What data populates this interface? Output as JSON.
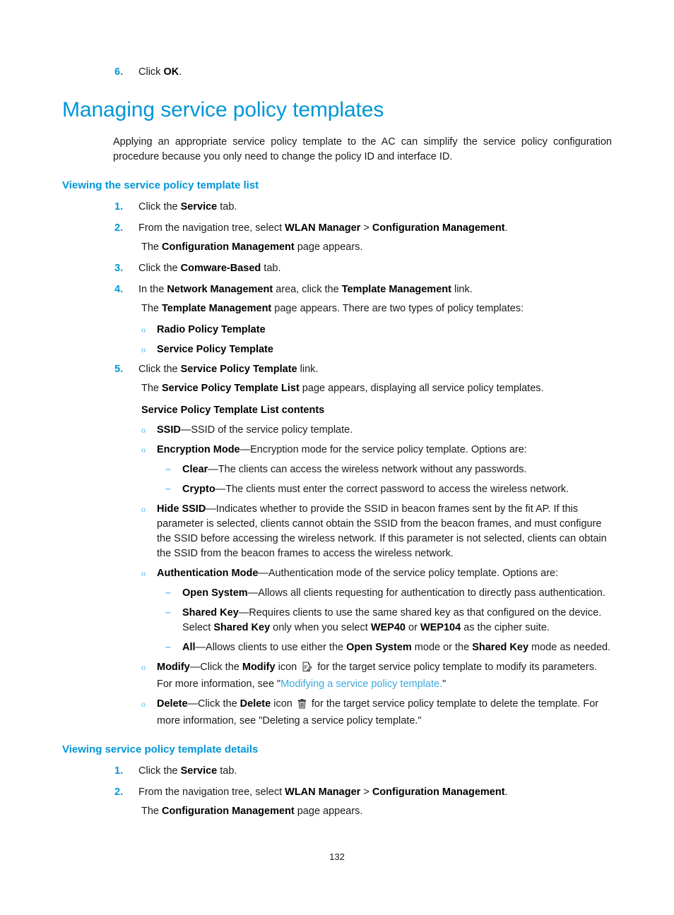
{
  "document": {
    "page_number": "132",
    "accent_color": "#0096D6",
    "bullet_color": "#52B8E8",
    "dash_color": "#6EC6EE",
    "link_color": "#3BA9DF"
  },
  "top_step": {
    "number": "6.",
    "text_before": "Click ",
    "bold": "OK",
    "text_after": "."
  },
  "heading": {
    "title": "Managing service policy templates",
    "intro": "Applying an appropriate service policy template to the AC can simplify the service policy configuration procedure because you only need to change the policy ID and interface ID."
  },
  "section_list": {
    "heading": "Viewing the service policy template list",
    "steps": [
      {
        "number": "1.",
        "parts": [
          {
            "t": "Click the ",
            "style": "normal"
          },
          {
            "t": "Service",
            "style": "bold"
          },
          {
            "t": " tab.",
            "style": "normal"
          }
        ]
      },
      {
        "number": "2.",
        "parts": [
          {
            "t": "From the navigation tree, select ",
            "style": "normal"
          },
          {
            "t": "WLAN Manager",
            "style": "bold"
          },
          {
            "t": " > ",
            "style": "normal"
          },
          {
            "t": "Configuration Management",
            "style": "bold"
          },
          {
            "t": ".",
            "style": "normal"
          }
        ],
        "follow": [
          {
            "t": "The ",
            "style": "normal"
          },
          {
            "t": "Configuration Management",
            "style": "bold"
          },
          {
            "t": " page appears.",
            "style": "normal"
          }
        ]
      },
      {
        "number": "3.",
        "parts": [
          {
            "t": "Click the ",
            "style": "normal"
          },
          {
            "t": "Comware-Based",
            "style": "bold"
          },
          {
            "t": " tab.",
            "style": "normal"
          }
        ]
      },
      {
        "number": "4.",
        "parts": [
          {
            "t": "In the ",
            "style": "normal"
          },
          {
            "t": "Network Management",
            "style": "bold"
          },
          {
            "t": " area, click the ",
            "style": "normal"
          },
          {
            "t": "Template Management",
            "style": "bold"
          },
          {
            "t": " link.",
            "style": "normal"
          }
        ],
        "follow": [
          {
            "t": "The ",
            "style": "normal"
          },
          {
            "t": "Template Management",
            "style": "bold"
          },
          {
            "t": " page appears. There are two types of policy templates:",
            "style": "normal"
          }
        ]
      }
    ],
    "template_types": [
      [
        {
          "t": "Radio Policy Template",
          "style": "bold"
        }
      ],
      [
        {
          "t": "Service Policy Template",
          "style": "bold"
        }
      ]
    ],
    "step5": {
      "number": "5.",
      "parts": [
        {
          "t": "Click the ",
          "style": "normal"
        },
        {
          "t": "Service Policy Template",
          "style": "bold"
        },
        {
          "t": " link.",
          "style": "normal"
        }
      ],
      "follow": [
        {
          "t": "The ",
          "style": "normal"
        },
        {
          "t": "Service Policy Template List",
          "style": "bold"
        },
        {
          "t": " page appears, displaying all service policy templates.",
          "style": "normal"
        }
      ]
    },
    "contents_heading": "Service Policy Template List contents",
    "contents": [
      {
        "parts": [
          {
            "t": "SSID",
            "style": "bold"
          },
          {
            "t": "—SSID of the service policy template.",
            "style": "normal"
          }
        ]
      },
      {
        "parts": [
          {
            "t": "Encryption Mode",
            "style": "bold"
          },
          {
            "t": "—Encryption mode for the service policy template. Options are:",
            "style": "normal"
          }
        ],
        "sub": [
          [
            {
              "t": "Clear",
              "style": "bold"
            },
            {
              "t": "—The clients can access the wireless network without any passwords.",
              "style": "normal"
            }
          ],
          [
            {
              "t": "Crypto",
              "style": "bold"
            },
            {
              "t": "—The clients must enter the correct password to access the wireless network.",
              "style": "normal"
            }
          ]
        ]
      },
      {
        "parts": [
          {
            "t": "Hide SSID",
            "style": "bold"
          },
          {
            "t": "—Indicates whether to provide the SSID in beacon frames sent by the fit AP. If this parameter is selected, clients cannot obtain the SSID from the beacon frames, and must configure the SSID before accessing the wireless network. If this parameter is not selected, clients can obtain the SSID from the beacon frames to access the wireless network.",
            "style": "normal"
          }
        ]
      },
      {
        "parts": [
          {
            "t": "Authentication Mode",
            "style": "bold"
          },
          {
            "t": "—Authentication mode of the service policy template. Options are:",
            "style": "normal"
          }
        ],
        "sub": [
          [
            {
              "t": "Open System",
              "style": "bold"
            },
            {
              "t": "—Allows all clients requesting for authentication to directly pass authentication.",
              "style": "normal"
            }
          ],
          [
            {
              "t": "Shared Key",
              "style": "bold"
            },
            {
              "t": "—Requires clients to use the same shared key as that configured on the device. Select ",
              "style": "normal"
            },
            {
              "t": "Shared Key",
              "style": "bold"
            },
            {
              "t": " only when you select ",
              "style": "normal"
            },
            {
              "t": "WEP40",
              "style": "bold"
            },
            {
              "t": " or ",
              "style": "normal"
            },
            {
              "t": "WEP104",
              "style": "bold"
            },
            {
              "t": " as the cipher suite.",
              "style": "normal"
            }
          ],
          [
            {
              "t": "All",
              "style": "bold"
            },
            {
              "t": "—Allows clients to use either the ",
              "style": "normal"
            },
            {
              "t": "Open System",
              "style": "bold"
            },
            {
              "t": " mode or the ",
              "style": "normal"
            },
            {
              "t": "Shared Key",
              "style": "bold"
            },
            {
              "t": " mode as needed.",
              "style": "normal"
            }
          ]
        ]
      },
      {
        "icon": "modify-icon",
        "parts": [
          {
            "t": "Modify",
            "style": "bold"
          },
          {
            "t": "—Click the ",
            "style": "normal"
          },
          {
            "t": "Modify",
            "style": "bold"
          },
          {
            "t": " icon ",
            "style": "normal"
          },
          {
            "t": "",
            "style": "icon-modify"
          },
          {
            "t": " for the target service policy template to modify its parameters. For more information, see \"",
            "style": "normal"
          },
          {
            "t": "Modifying a service policy template.",
            "style": "link"
          },
          {
            "t": "\"",
            "style": "normal"
          }
        ]
      },
      {
        "icon": "delete-icon",
        "parts": [
          {
            "t": "Delete",
            "style": "bold"
          },
          {
            "t": "—Click the ",
            "style": "normal"
          },
          {
            "t": "Delete",
            "style": "bold"
          },
          {
            "t": " icon ",
            "style": "normal"
          },
          {
            "t": "",
            "style": "icon-delete"
          },
          {
            "t": " for the target service policy template to delete the template. For more information, see \"Deleting a service policy template.\"",
            "style": "normal"
          }
        ]
      }
    ]
  },
  "section_details": {
    "heading": "Viewing service policy template details",
    "steps": [
      {
        "number": "1.",
        "parts": [
          {
            "t": "Click the ",
            "style": "normal"
          },
          {
            "t": "Service",
            "style": "bold"
          },
          {
            "t": " tab.",
            "style": "normal"
          }
        ]
      },
      {
        "number": "2.",
        "parts": [
          {
            "t": "From the navigation tree, select ",
            "style": "normal"
          },
          {
            "t": "WLAN Manager",
            "style": "bold"
          },
          {
            "t": " > ",
            "style": "normal"
          },
          {
            "t": "Configuration Management",
            "style": "bold"
          },
          {
            "t": ".",
            "style": "normal"
          }
        ],
        "follow": [
          {
            "t": "The ",
            "style": "normal"
          },
          {
            "t": "Configuration Management",
            "style": "bold"
          },
          {
            "t": " page appears.",
            "style": "normal"
          }
        ]
      }
    ]
  },
  "icons": {
    "modify": "modify-icon",
    "delete": "delete-icon",
    "bullet_o": "o",
    "bullet_dash": "–"
  }
}
